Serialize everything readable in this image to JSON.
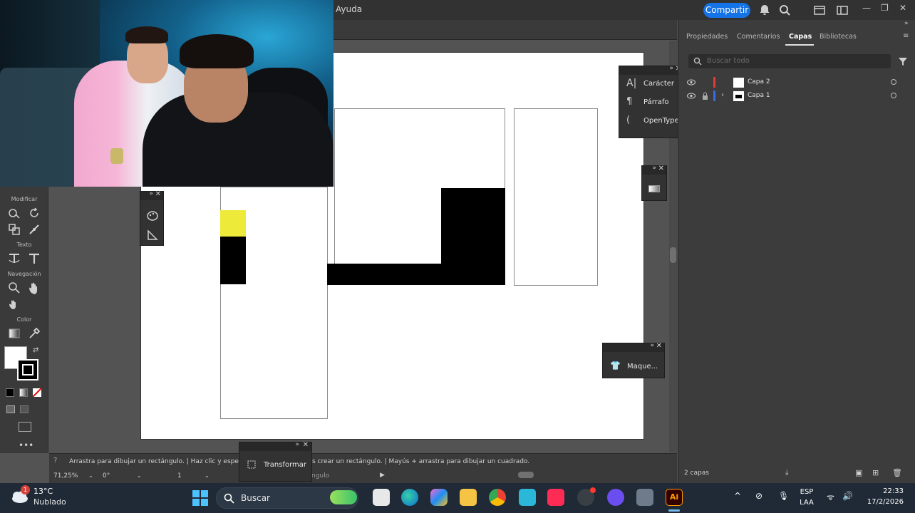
{
  "menu": {
    "help": "Ayuda"
  },
  "header": {
    "share_label": "Compartir"
  },
  "toolbar": {
    "sections": {
      "modify": "Modificar",
      "text": "Texto",
      "navigation": "Navegación",
      "color": "Color"
    }
  },
  "floating_panels": {
    "character": "Carácter",
    "paragraph": "Párrafo",
    "opentype": "OpenType",
    "mockup": "Maque...",
    "transform": "Transformar"
  },
  "right_panel": {
    "tabs": [
      {
        "label": "Propiedades"
      },
      {
        "label": "Comentarios"
      },
      {
        "label": "Capas",
        "active": true
      },
      {
        "label": "Bibliotecas"
      }
    ],
    "search_placeholder": "Buscar todo",
    "layers": [
      {
        "name": "Capa 2",
        "color": "#e23b3b"
      },
      {
        "name": "Capa 1",
        "color": "#3b6de2"
      }
    ],
    "layer_count": "2 capas"
  },
  "status": {
    "hint_part1": "Arrastra para dibujar un rectángulo.  |  Haz clic y espe",
    "hint_part2": "s crear un rectángulo.  |  Mayús + arrastra para dibujar un cuadrado.",
    "zoom": "71,25%",
    "rotation": "0°",
    "page": "1",
    "tool_hint": "ngulo"
  },
  "taskbar": {
    "weather_temp": "13°C",
    "weather_desc": "Nublado",
    "weather_badge": "1",
    "search_label": "Buscar",
    "lang": "ESP",
    "lang_sub": "LAA",
    "time": "22:33",
    "date": "17/2/2026",
    "illustrator_label": "Ai"
  },
  "colors": {
    "accent": "#1473e6",
    "yellow_shape": "#eeea3a",
    "taskbar_bg": "#1f2a36"
  }
}
